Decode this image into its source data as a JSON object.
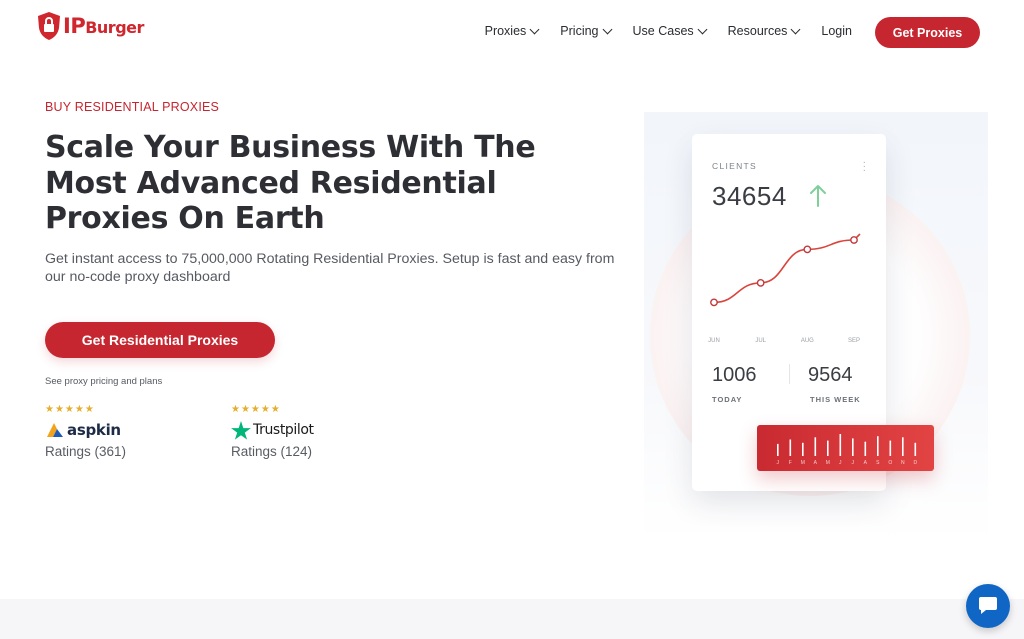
{
  "brand": {
    "name_prefix": "IP",
    "name_suffix": "Burger",
    "accent": "#c62630"
  },
  "nav": {
    "items": [
      {
        "label": "Proxies",
        "has_dropdown": true
      },
      {
        "label": "Pricing",
        "has_dropdown": true
      },
      {
        "label": "Use Cases",
        "has_dropdown": true
      },
      {
        "label": "Resources",
        "has_dropdown": true
      },
      {
        "label": "Login",
        "has_dropdown": false
      }
    ],
    "cta": "Get Proxies"
  },
  "hero": {
    "eyebrow": "BUY RESIDENTIAL PROXIES",
    "headline": "Scale Your Business With The Most Advanced Residential Proxies On Earth",
    "subtext": "Get instant access to 75,000,000 Rotating Residential Proxies. Setup is fast and easy from our no-code proxy dashboard",
    "cta": "Get Residential Proxies",
    "pricing_link": "See proxy pricing and plans"
  },
  "ratings": [
    {
      "stars": "★★★★★",
      "brand": "aspkin",
      "count_text": "Ratings (361)"
    },
    {
      "stars": "★★★★★",
      "brand": "Trustpilot",
      "count_text": "Ratings (124)"
    }
  ],
  "dashboard": {
    "label": "CLIENTS",
    "value": "34654",
    "trend_icon": "up-arrow-icon",
    "chart_data": {
      "type": "line",
      "categories": [
        "JUN",
        "JUL",
        "AUG",
        "SEP"
      ],
      "values": [
        20,
        45,
        88,
        100
      ]
    },
    "stats": [
      {
        "value": "1006",
        "label": "TODAY"
      },
      {
        "value": "9564",
        "label": "THIS WEEK"
      }
    ],
    "bar_months": [
      "J",
      "F",
      "M",
      "A",
      "M",
      "J",
      "J",
      "A",
      "S",
      "O",
      "N",
      "D"
    ],
    "bar_values": [
      0.55,
      0.75,
      0.6,
      0.85,
      0.7,
      1.0,
      0.8,
      0.65,
      0.9,
      0.7,
      0.85,
      0.6
    ]
  },
  "chat": {
    "icon": "chat-bubble-icon"
  }
}
